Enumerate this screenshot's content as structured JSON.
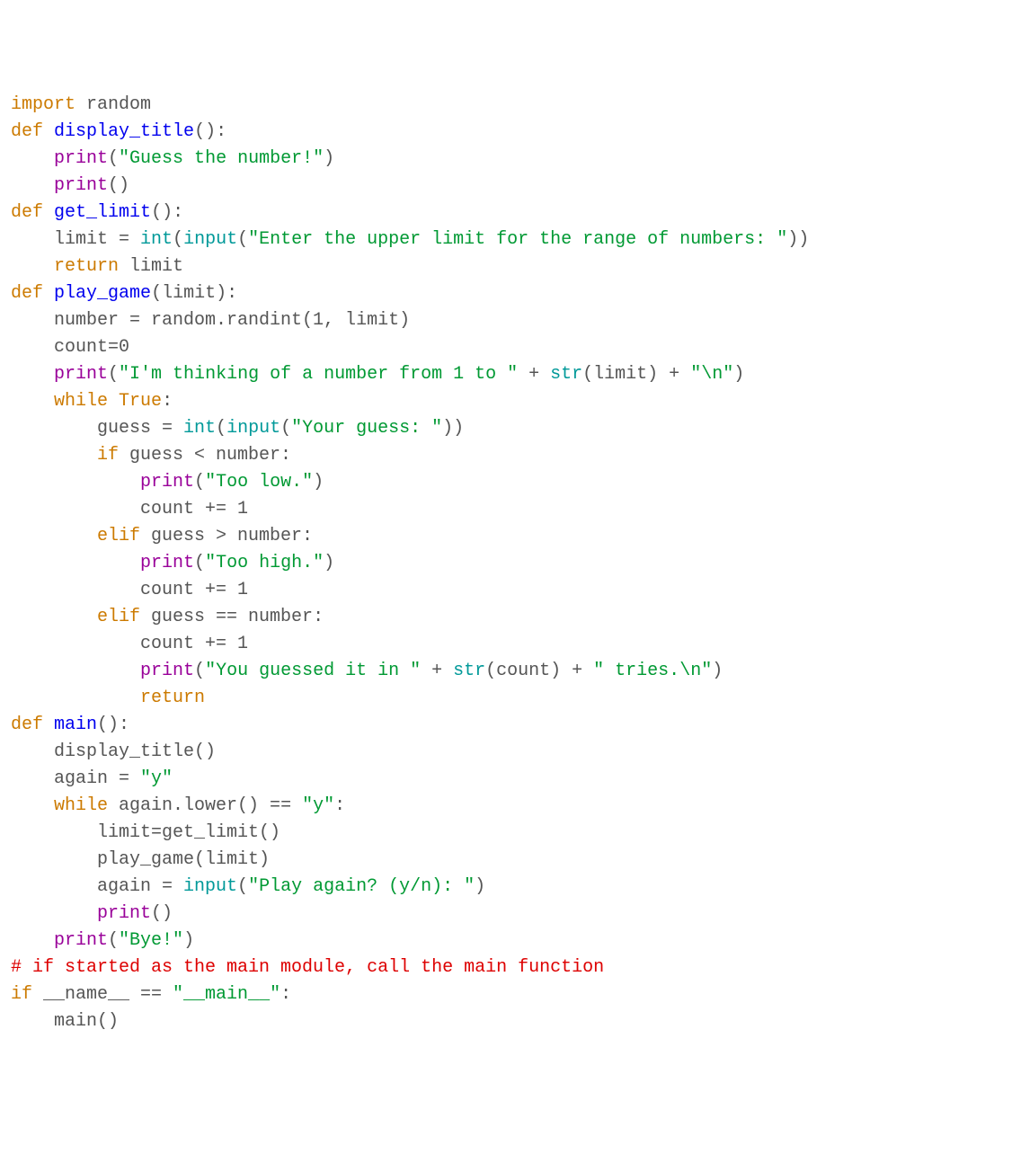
{
  "colors": {
    "kw_orange": "#cc7a00",
    "fn_blue": "#0000ee",
    "call_purple": "#990099",
    "builtin_teal": "#009999",
    "str_green": "#009933",
    "cmt_red": "#dd0000",
    "plain": "#555555"
  },
  "lines": [
    [
      [
        "kw-orange",
        "import"
      ],
      [
        "plain",
        " random"
      ]
    ],
    [
      [
        "plain",
        ""
      ]
    ],
    [
      [
        "kw-orange",
        "def"
      ],
      [
        "plain",
        " "
      ],
      [
        "fn-blue",
        "display_title"
      ],
      [
        "plain",
        "():"
      ]
    ],
    [
      [
        "plain",
        "    "
      ],
      [
        "call-purple",
        "print"
      ],
      [
        "plain",
        "("
      ],
      [
        "str-green",
        "\"Guess the number!\""
      ],
      [
        "plain",
        ")"
      ]
    ],
    [
      [
        "plain",
        "    "
      ],
      [
        "call-purple",
        "print"
      ],
      [
        "plain",
        "()"
      ]
    ],
    [
      [
        "plain",
        ""
      ]
    ],
    [
      [
        "kw-orange",
        "def"
      ],
      [
        "plain",
        " "
      ],
      [
        "fn-blue",
        "get_limit"
      ],
      [
        "plain",
        "():"
      ]
    ],
    [
      [
        "plain",
        "    limit = "
      ],
      [
        "builtin-teal",
        "int"
      ],
      [
        "plain",
        "("
      ],
      [
        "builtin-teal",
        "input"
      ],
      [
        "plain",
        "("
      ],
      [
        "str-green",
        "\"Enter the upper limit for the range of numbers: \""
      ],
      [
        "plain",
        "))"
      ]
    ],
    [
      [
        "plain",
        "    "
      ],
      [
        "kw-orange",
        "return"
      ],
      [
        "plain",
        " limit"
      ]
    ],
    [
      [
        "plain",
        ""
      ]
    ],
    [
      [
        "kw-orange",
        "def"
      ],
      [
        "plain",
        " "
      ],
      [
        "fn-blue",
        "play_game"
      ],
      [
        "plain",
        "(limit):"
      ]
    ],
    [
      [
        "plain",
        "    number = random.randint(1, limit)"
      ]
    ],
    [
      [
        "plain",
        "    count=0"
      ]
    ],
    [
      [
        "plain",
        "    "
      ],
      [
        "call-purple",
        "print"
      ],
      [
        "plain",
        "("
      ],
      [
        "str-green",
        "\"I'm thinking of a number from 1 to \""
      ],
      [
        "plain",
        " + "
      ],
      [
        "builtin-teal",
        "str"
      ],
      [
        "plain",
        "(limit) + "
      ],
      [
        "str-green",
        "\"\\n\""
      ],
      [
        "plain",
        ")"
      ]
    ],
    [
      [
        "plain",
        "    "
      ],
      [
        "kw-orange",
        "while"
      ],
      [
        "plain",
        " "
      ],
      [
        "kw-orange",
        "True"
      ],
      [
        "plain",
        ":"
      ]
    ],
    [
      [
        "plain",
        "        guess = "
      ],
      [
        "builtin-teal",
        "int"
      ],
      [
        "plain",
        "("
      ],
      [
        "builtin-teal",
        "input"
      ],
      [
        "plain",
        "("
      ],
      [
        "str-green",
        "\"Your guess: \""
      ],
      [
        "plain",
        "))"
      ]
    ],
    [
      [
        "plain",
        "        "
      ],
      [
        "kw-orange",
        "if"
      ],
      [
        "plain",
        " guess < number:"
      ]
    ],
    [
      [
        "plain",
        "            "
      ],
      [
        "call-purple",
        "print"
      ],
      [
        "plain",
        "("
      ],
      [
        "str-green",
        "\"Too low.\""
      ],
      [
        "plain",
        ")"
      ]
    ],
    [
      [
        "plain",
        "            count += 1"
      ]
    ],
    [
      [
        "plain",
        "        "
      ],
      [
        "kw-orange",
        "elif"
      ],
      [
        "plain",
        " guess > number:"
      ]
    ],
    [
      [
        "plain",
        "            "
      ],
      [
        "call-purple",
        "print"
      ],
      [
        "plain",
        "("
      ],
      [
        "str-green",
        "\"Too high.\""
      ],
      [
        "plain",
        ")"
      ]
    ],
    [
      [
        "plain",
        "            count += 1"
      ]
    ],
    [
      [
        "plain",
        "        "
      ],
      [
        "kw-orange",
        "elif"
      ],
      [
        "plain",
        " guess == number:"
      ]
    ],
    [
      [
        "plain",
        "            count += 1"
      ]
    ],
    [
      [
        "plain",
        "            "
      ],
      [
        "call-purple",
        "print"
      ],
      [
        "plain",
        "("
      ],
      [
        "str-green",
        "\"You guessed it in \""
      ],
      [
        "plain",
        " + "
      ],
      [
        "builtin-teal",
        "str"
      ],
      [
        "plain",
        "(count) + "
      ],
      [
        "str-green",
        "\" tries.\\n\""
      ],
      [
        "plain",
        ")"
      ]
    ],
    [
      [
        "plain",
        "            "
      ],
      [
        "kw-orange",
        "return"
      ]
    ],
    [
      [
        "plain",
        ""
      ]
    ],
    [
      [
        "kw-orange",
        "def"
      ],
      [
        "plain",
        " "
      ],
      [
        "fn-blue",
        "main"
      ],
      [
        "plain",
        "():"
      ]
    ],
    [
      [
        "plain",
        "    display_title()"
      ]
    ],
    [
      [
        "plain",
        "    again = "
      ],
      [
        "str-green",
        "\"y\""
      ]
    ],
    [
      [
        "plain",
        "    "
      ],
      [
        "kw-orange",
        "while"
      ],
      [
        "plain",
        " again.lower() == "
      ],
      [
        "str-green",
        "\"y\""
      ],
      [
        "plain",
        ":"
      ]
    ],
    [
      [
        "plain",
        "        limit=get_limit()"
      ]
    ],
    [
      [
        "plain",
        "        play_game(limit)"
      ]
    ],
    [
      [
        "plain",
        "        again = "
      ],
      [
        "builtin-teal",
        "input"
      ],
      [
        "plain",
        "("
      ],
      [
        "str-green",
        "\"Play again? (y/n): \""
      ],
      [
        "plain",
        ")"
      ]
    ],
    [
      [
        "plain",
        "        "
      ],
      [
        "call-purple",
        "print"
      ],
      [
        "plain",
        "()"
      ]
    ],
    [
      [
        "plain",
        "    "
      ],
      [
        "call-purple",
        "print"
      ],
      [
        "plain",
        "("
      ],
      [
        "str-green",
        "\"Bye!\""
      ],
      [
        "plain",
        ")"
      ]
    ],
    [
      [
        "plain",
        ""
      ]
    ],
    [
      [
        "cmt-red",
        "# if started as the main module, call the main function"
      ]
    ],
    [
      [
        "kw-orange",
        "if"
      ],
      [
        "plain",
        " __name__ == "
      ],
      [
        "str-green",
        "\"__main__\""
      ],
      [
        "plain",
        ":"
      ]
    ],
    [
      [
        "plain",
        "    main()"
      ]
    ]
  ]
}
